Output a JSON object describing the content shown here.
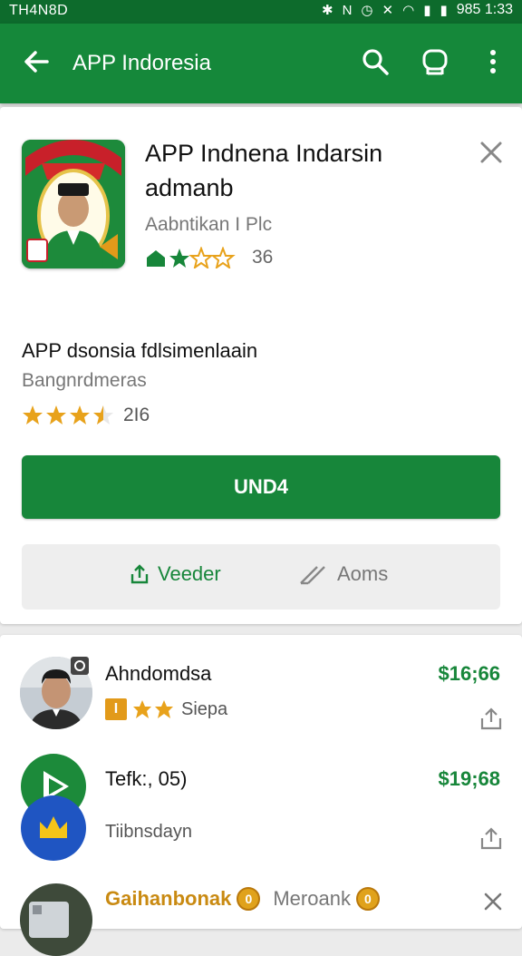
{
  "status_bar": {
    "left_text": "TH4N8D",
    "right_text": "985 1:33"
  },
  "app_bar": {
    "title": "APP Indoresia"
  },
  "app_card": {
    "title": "APP Indnena Indarsin admanb",
    "developer": "Aabntikan I Plc",
    "rating_count": "36",
    "sub_title": "APP dsonsia fdlsimenlaain",
    "category": "Bangnrdmeras",
    "sub_rating_count": "2I6",
    "install_label": "UND4",
    "share_label": "Veeder",
    "other_label": "Aoms"
  },
  "list": [
    {
      "name": "Ahndomdsa",
      "price": "$16;66",
      "sub": "Siepa",
      "badge": "I"
    },
    {
      "name": "Tefk:, 05)",
      "price": "$19;68",
      "sub": "Tiibnsdayn"
    },
    {
      "name": "Gaihanbonak",
      "secondary": "Meroank"
    }
  ],
  "colors": {
    "primary": "#15883a",
    "primary_dark": "#0d6b2c",
    "star": "#e8a21b"
  }
}
